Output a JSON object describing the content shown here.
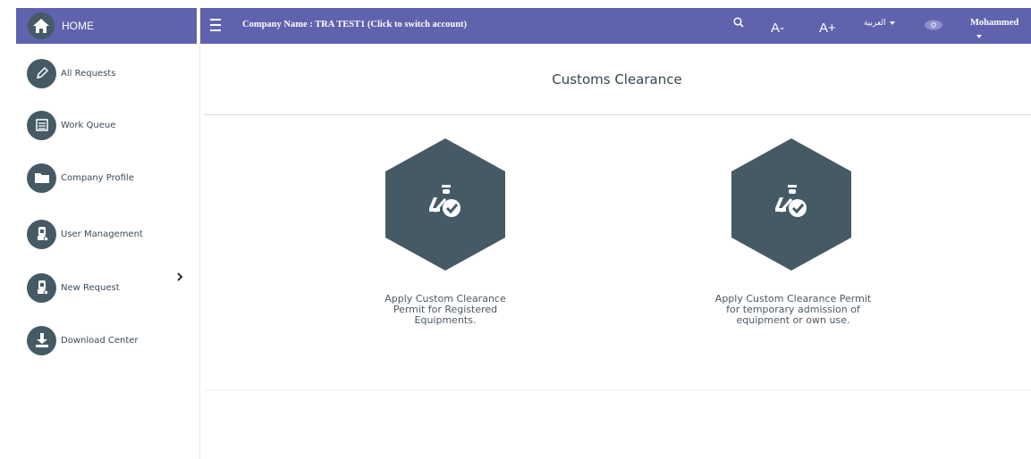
{
  "topbar": {
    "home_label": "HOME",
    "company": "Company Name : TRA TEST1 (Click to switch account)",
    "font_decrease": "A-",
    "font_increase": "A+",
    "language": "العربية",
    "user": "Mohammed"
  },
  "sidebar": {
    "items": [
      {
        "label": "All Requests",
        "icon": "pencil-icon"
      },
      {
        "label": "Work Queue",
        "icon": "tray-icon"
      },
      {
        "label": "Company Profile",
        "icon": "folder-icon"
      },
      {
        "label": "User Management",
        "icon": "user-lock-icon"
      },
      {
        "label": "New Request",
        "icon": "user-lock-icon"
      },
      {
        "label": "Download Center",
        "icon": "download-icon"
      }
    ]
  },
  "main": {
    "title": "Customs Clearance",
    "cards": [
      {
        "text": "Apply Custom Clearance Permit for Registered Equipments.",
        "icon": "customs-officer-check-icon"
      },
      {
        "text": "Apply Custom Clearance Permit for temporary admission of equipment or own use.",
        "icon": "customs-officer-check-icon"
      }
    ]
  },
  "colors": {
    "header_bg": "#5f62ad",
    "icon_bg": "#455a64",
    "text": "#3b4a57"
  }
}
